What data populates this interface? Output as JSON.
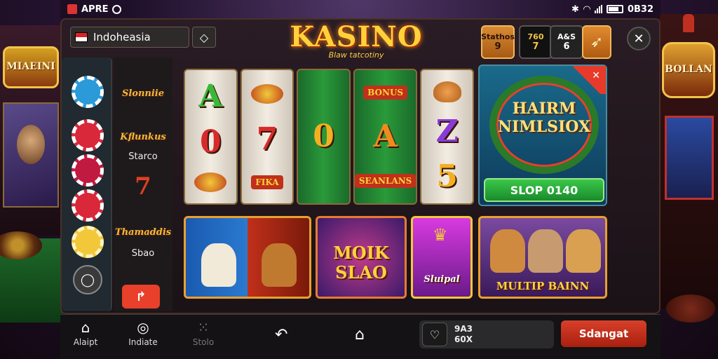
{
  "status_bar": {
    "left_text": "APRE",
    "right_text": "0B32"
  },
  "header": {
    "country": "Indoheasia",
    "logo_title": "KASINO",
    "logo_subtitle": "Blaw tatcotiny",
    "stats": [
      {
        "label": "Stathos",
        "value": "9"
      },
      {
        "label": "760",
        "value": "7"
      },
      {
        "label": "A&S",
        "value": "6"
      }
    ]
  },
  "sidebar": {
    "chips": [
      "blue-chip",
      "red-chip",
      "red-chip",
      "red-chip",
      "gold-chip"
    ],
    "categories": [
      {
        "title": "Slonniie"
      },
      {
        "title": "Kflunkus",
        "label": "Starco"
      },
      {
        "title": "Thamaddis",
        "label": "Sbao"
      }
    ],
    "arrow_button": "↱"
  },
  "reels": [
    {
      "style": "light",
      "symbols": [
        "A",
        "0"
      ]
    },
    {
      "style": "light",
      "symbols": [
        "7"
      ],
      "badge": "FIKA"
    },
    {
      "style": "green",
      "symbols": [
        "0"
      ]
    },
    {
      "style": "green",
      "symbols": [
        "A"
      ],
      "badge_top": "BONUS",
      "badge": "SEANLANS"
    },
    {
      "style": "light",
      "symbols": [
        "Z",
        "5"
      ]
    }
  ],
  "promo": {
    "title": "HAIRM NIMLSIOX",
    "button": "SLOP 0140",
    "corner_icon": "hammer-icon"
  },
  "tiles": [
    {
      "label": ""
    },
    {
      "label": "MOIK SLAO"
    },
    {
      "label": "Sluipal"
    },
    {
      "label": "MULTIP BAINN"
    }
  ],
  "bottom_nav": {
    "items": [
      {
        "label": "Alaipt",
        "icon": "home-icon"
      },
      {
        "label": "Indiate",
        "icon": "chat-icon"
      },
      {
        "label": "Stolo",
        "icon": "grid-icon"
      }
    ],
    "wallet_line1": "9A3",
    "wallet_line2": "60X",
    "signup": "Sdangat"
  },
  "colors": {
    "accent": "#ffd23a",
    "cta": "#d8402a",
    "promo_button": "#2a9a3a"
  }
}
